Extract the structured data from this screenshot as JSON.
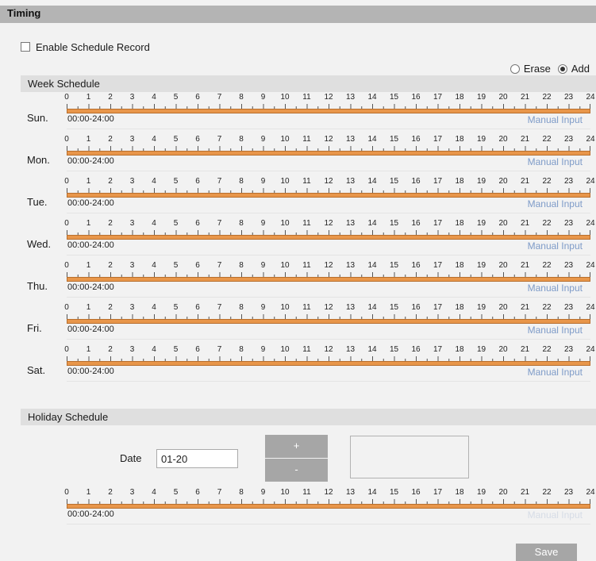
{
  "header": {
    "title": "Timing"
  },
  "enable_schedule": {
    "label": "Enable Schedule Record",
    "checked": false
  },
  "mode": {
    "erase_label": "Erase",
    "add_label": "Add",
    "selected": "Add"
  },
  "week_schedule": {
    "title": "Week Schedule",
    "hour_labels": [
      "0",
      "1",
      "2",
      "3",
      "4",
      "5",
      "6",
      "7",
      "8",
      "9",
      "10",
      "11",
      "12",
      "13",
      "14",
      "15",
      "16",
      "17",
      "18",
      "19",
      "20",
      "21",
      "22",
      "23",
      "24"
    ],
    "days": [
      {
        "label": "Sun.",
        "range": "00:00-24:00",
        "manual_input": "Manual Input"
      },
      {
        "label": "Mon.",
        "range": "00:00-24:00",
        "manual_input": "Manual Input"
      },
      {
        "label": "Tue.",
        "range": "00:00-24:00",
        "manual_input": "Manual Input"
      },
      {
        "label": "Wed.",
        "range": "00:00-24:00",
        "manual_input": "Manual Input"
      },
      {
        "label": "Thu.",
        "range": "00:00-24:00",
        "manual_input": "Manual Input"
      },
      {
        "label": "Fri.",
        "range": "00:00-24:00",
        "manual_input": "Manual Input"
      },
      {
        "label": "Sat.",
        "range": "00:00-24:00",
        "manual_input": "Manual Input"
      }
    ]
  },
  "holiday_schedule": {
    "title": "Holiday Schedule",
    "date_label": "Date",
    "date_value": "01-20",
    "add_button": "+",
    "remove_button": "-",
    "range": "00:00-24:00",
    "manual_input": "Manual Input"
  },
  "colors": {
    "bar_fill": "#e8964a",
    "link": "#7e9bc8",
    "header_bg": "#b4b4b4"
  },
  "save_label": "Save"
}
